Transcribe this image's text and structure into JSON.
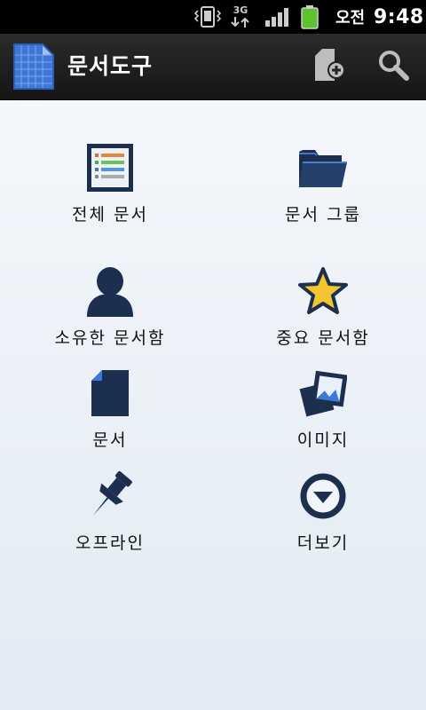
{
  "status_bar": {
    "network": "3G",
    "ampm": "오전",
    "time": "9:48",
    "icons": [
      "vibrate-icon",
      "data-transfer-icon",
      "signal-icon",
      "battery-icon"
    ]
  },
  "action_bar": {
    "title": "문서도구",
    "actions": [
      "new-document-icon",
      "search-icon"
    ]
  },
  "menu": {
    "items": [
      {
        "label": "전체 문서",
        "icon": "all-documents-icon"
      },
      {
        "label": "문서 그룹",
        "icon": "folder-icon"
      },
      {
        "label": "소유한 문서함",
        "icon": "person-icon"
      },
      {
        "label": "중요 문서함",
        "icon": "star-icon"
      },
      {
        "label": "문서",
        "icon": "document-icon"
      },
      {
        "label": "이미지",
        "icon": "image-icon"
      },
      {
        "label": "오프라인",
        "icon": "pin-icon"
      },
      {
        "label": "더보기",
        "icon": "more-icon"
      }
    ]
  },
  "colors": {
    "icon_dark": "#1c2f4f",
    "star": "#f2c531",
    "accent_blue": "#3d78d8",
    "battery": "#5cc22f"
  }
}
